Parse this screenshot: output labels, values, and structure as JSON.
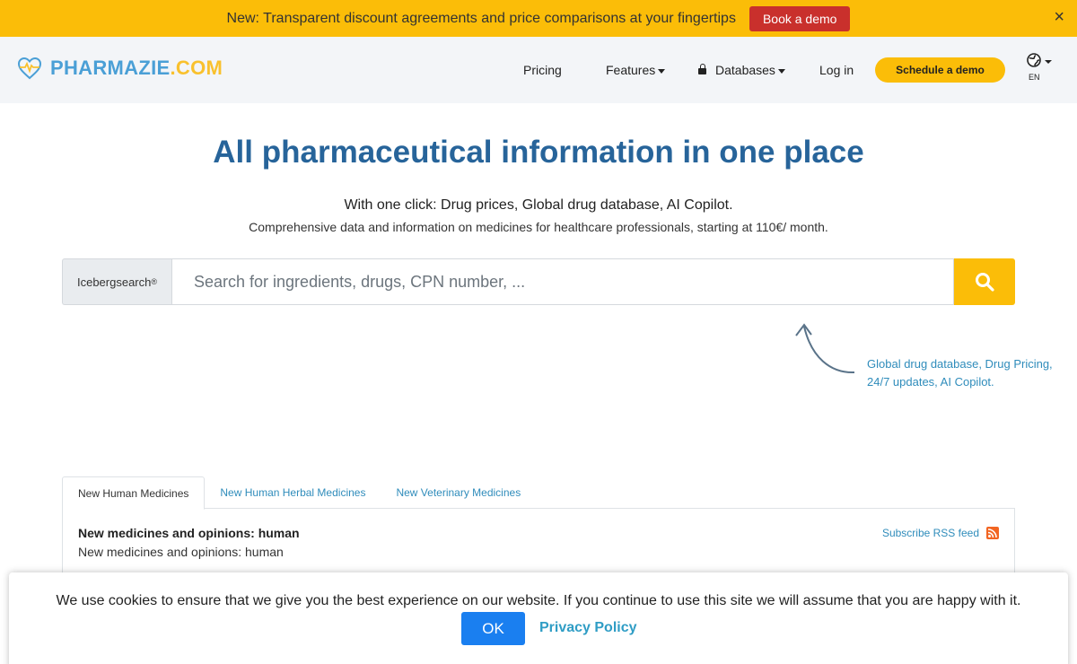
{
  "announcement": {
    "text": "New: Transparent discount agreements and price comparisons at your fingertips",
    "button_label": "Book a demo",
    "close_label": "×"
  },
  "header": {
    "logo_part1": "PHARMAZIE",
    "logo_part2": ".COM",
    "nav": {
      "pricing": "Pricing",
      "features": "Features",
      "databases": "Databases",
      "login": "Log in"
    },
    "cta_label": "Schedule a demo",
    "language": "EN"
  },
  "hero": {
    "title": "All pharmaceutical information in one place",
    "subtitle": "With one click: Drug prices, Global drug database, AI Copilot.",
    "description": "Comprehensive data and information on medicines for healthcare professionals, starting at 110€/ month."
  },
  "search": {
    "label": "Icebergsearch",
    "label_mark": "®",
    "placeholder": "Search for ingredients, drugs, CPN number, ...",
    "value": "",
    "hint": "Global drug database, Drug Pricing, 24/7 updates, AI Copilot."
  },
  "tabs": [
    {
      "label": "New Human Medicines",
      "active": true
    },
    {
      "label": "New Human Herbal Medicines",
      "active": false
    },
    {
      "label": "New Veterinary Medicines",
      "active": false
    }
  ],
  "panel": {
    "title": "New medicines and opinions: human",
    "description": "New medicines and opinions: human",
    "rss_label": "Subscribe RSS feed"
  },
  "cookie": {
    "text": "We use cookies to ensure that we give you the best experience on our website. If you continue to use this site we will assume that you are happy with it.",
    "ok_label": "OK",
    "privacy_label": "Privacy Policy"
  },
  "colors": {
    "brand_yellow": "#fbbd08",
    "brand_blue": "#27649a",
    "link_blue": "#2f8cbb",
    "demo_red": "#c9302c",
    "ok_blue": "#1a7ff0"
  }
}
